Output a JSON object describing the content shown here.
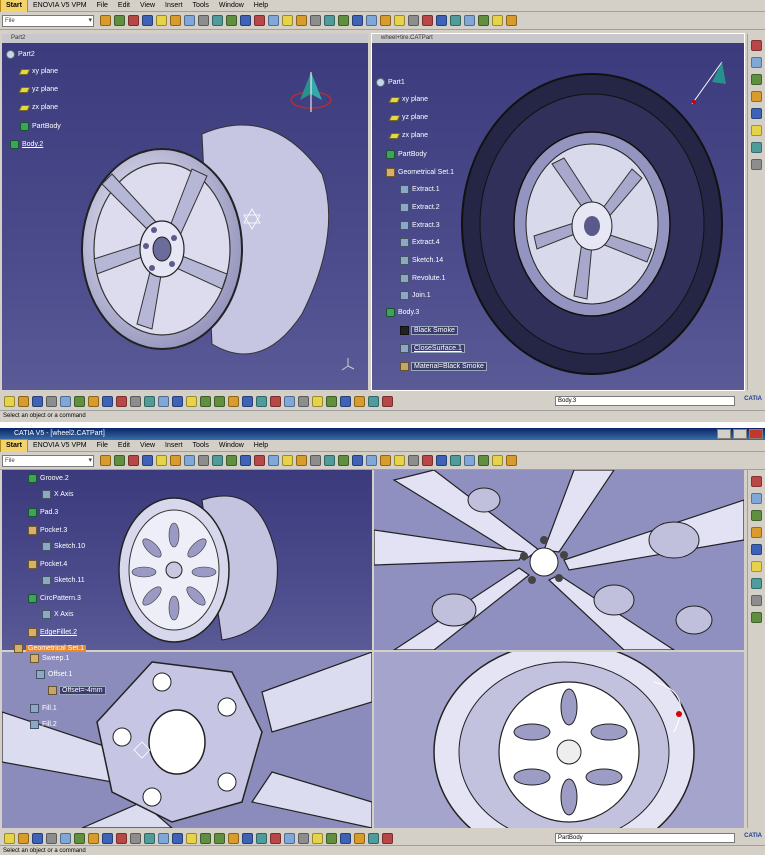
{
  "screen1": {
    "menu": [
      "Start",
      "ENOVIA V5 VPM",
      "File",
      "Edit",
      "View",
      "Insert",
      "Tools",
      "Window",
      "Help"
    ],
    "toolbar_combo": "File",
    "left_window": {
      "title": "Part2",
      "tree": [
        "Part2",
        "xy plane",
        "yz plane",
        "zx plane",
        "PartBody",
        "Body.2"
      ]
    },
    "right_window": {
      "title": "wheel+tire.CATPart",
      "tree": [
        "Part1",
        "xy plane",
        "yz plane",
        "zx plane",
        "PartBody",
        "Geometrical Set.1",
        "Extract.1",
        "Extract.2",
        "Extract.3",
        "Extract.4",
        "Sketch.14",
        "Revolute.1",
        "Join.1",
        "Body.3",
        "Black Smoke",
        "CloseSurface.1",
        "Material=Black Smoke"
      ]
    },
    "body_combo": "Body.3",
    "status": "Select an object or a command",
    "logo": "CATIA"
  },
  "screen2": {
    "title": "CATIA V5 - [wheel2.CATPart]",
    "menu": [
      "Start",
      "ENOVIA V5 VPM",
      "File",
      "Edit",
      "View",
      "Insert",
      "Tools",
      "Window",
      "Help"
    ],
    "toolbar_combo": "File",
    "tree": [
      "Groove.2",
      "X Axis",
      "Pad.3",
      "Pocket.3",
      "Sketch.10",
      "Pocket.4",
      "Sketch.11",
      "CircPattern.3",
      "X Axis",
      "EdgeFillet.2",
      "Geometrical Set.1",
      "Sweep.1",
      "Offset.1",
      "Offset=-4mm",
      "Fill.1",
      "Fill.2"
    ],
    "body_combo": "PartBody",
    "status": "Select an object or a command",
    "logo": "CATIA"
  }
}
